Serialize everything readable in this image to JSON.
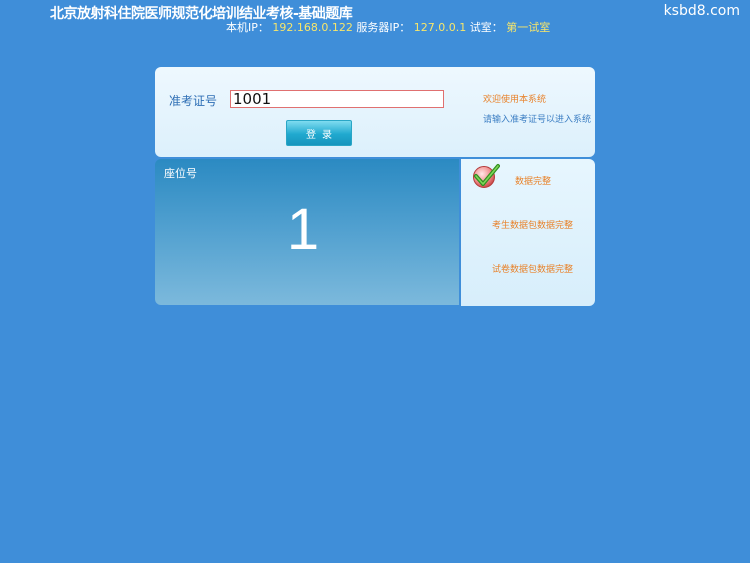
{
  "header": {
    "title": "北京放射科住院医师规范化培训结业考核-基础题库",
    "site_mark": "ksbd8.com",
    "local_ip_label": "本机IP：",
    "local_ip": "192.168.0.122",
    "server_ip_label": "服务器IP：",
    "server_ip": "127.0.0.1",
    "room_label": "试室：",
    "room": "第一试室",
    "value_color": "#f7e66b"
  },
  "login": {
    "label": "准考证号",
    "input_value": "1001",
    "button_label": "登录",
    "welcome": "欢迎使用本系统",
    "hint": "请输入准考证号以进入系统"
  },
  "seat": {
    "label": "座位号",
    "number": "1"
  },
  "status": {
    "icon": "check-icon",
    "complete": "数据完整",
    "candidate_package": "考生数据包数据完整",
    "paper_package": "试卷数据包数据完整",
    "text_color": "#e8832c"
  },
  "colors": {
    "background": "#3f8ed9",
    "label_blue": "#2f6fb5"
  }
}
